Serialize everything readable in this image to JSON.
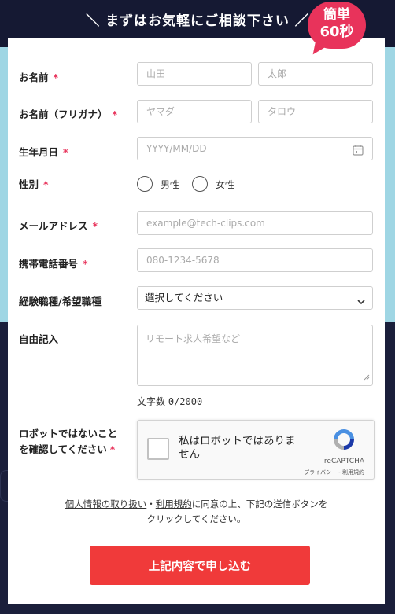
{
  "header": {
    "title": "＼ まずはお気軽にご相談下さい ／",
    "badge_line1": "簡単",
    "badge_line2": "60秒"
  },
  "required_mark": "*",
  "form": {
    "name": {
      "label": "お名前",
      "last_placeholder": "山田",
      "first_placeholder": "太郎"
    },
    "name_kana": {
      "label": "お名前（フリガナ）",
      "last_placeholder": "ヤマダ",
      "first_placeholder": "タロウ"
    },
    "birthdate": {
      "label": "生年月日",
      "placeholder": "YYYY/MM/DD"
    },
    "gender": {
      "label": "性別",
      "options": [
        "男性",
        "女性"
      ]
    },
    "email": {
      "label": "メールアドレス",
      "placeholder": "example@tech-clips.com"
    },
    "phone": {
      "label": "携帯電話番号",
      "placeholder": "080-1234-5678"
    },
    "job": {
      "label": "経験職種/希望職種",
      "selected": "選択してください"
    },
    "free_text": {
      "label": "自由記入",
      "placeholder": "リモート求人希望など",
      "counter_prefix": "文字数",
      "counter_value": "0/2000"
    },
    "captcha": {
      "label_line1": "ロボットではないこと",
      "label_line2": "を確認してください",
      "checkbox_text": "私はロボットではありません",
      "brand": "reCAPTCHA",
      "privacy": "プライバシー",
      "separator": " - ",
      "terms": "利用規約"
    },
    "consent": {
      "link1": "個人情報の取り扱い",
      "dot": "・",
      "link2": "利用規約",
      "text_line1_rest": "に同意の上、下記の送信ボタンを",
      "text_line2": "クリックしてください。"
    },
    "submit_label": "上記内容で申し込む"
  },
  "colors": {
    "required": "#e8335b",
    "badge": "#e8335b",
    "submit": "#f03a3a",
    "band_teal": "#9fd6e4",
    "navy": "#1b1f3b"
  },
  "icons": [
    "calendar-icon",
    "chevron-down-icon",
    "recaptcha-logo-icon",
    "resize-grip-icon"
  ]
}
